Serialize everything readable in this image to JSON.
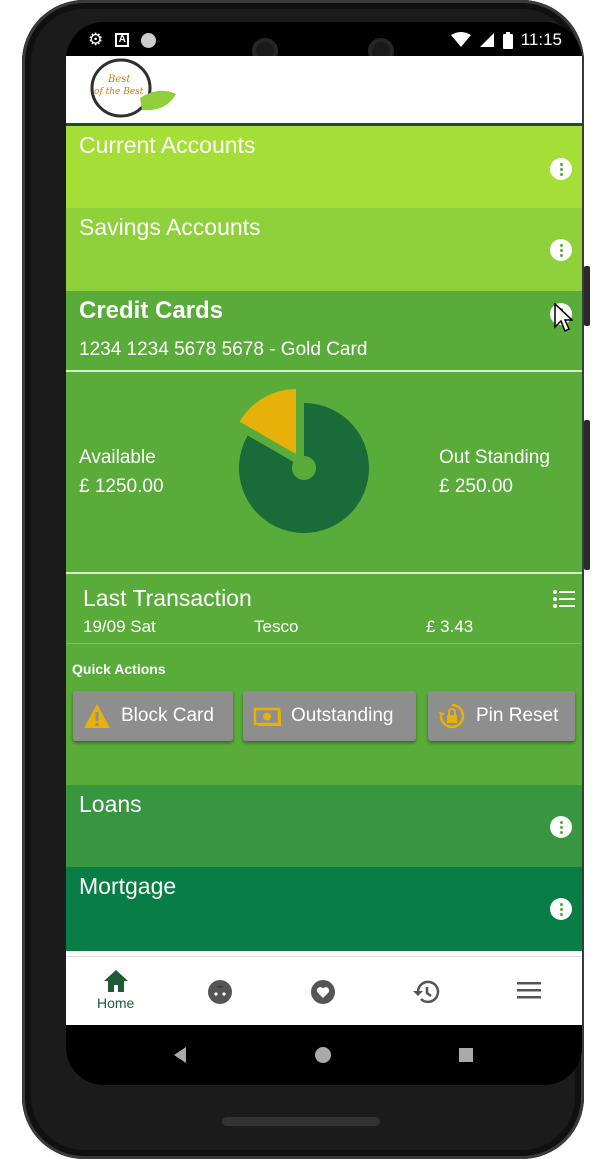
{
  "status_bar": {
    "time": "11:15",
    "icons_left": [
      "gear-icon",
      "a-icon",
      "circle-icon"
    ],
    "icons_right": [
      "wifi-icon",
      "signal-icon",
      "battery-icon"
    ]
  },
  "logo": {
    "line1": "Best",
    "line2": "of the Best"
  },
  "sections": {
    "current": {
      "title": "Current Accounts"
    },
    "savings": {
      "title": "Savings Accounts"
    },
    "credit": {
      "title": "Credit Cards",
      "card_number": "1234 1234 5678 5678 - Gold Card",
      "available_label": "Available",
      "available_value": "£ 1250.00",
      "outstanding_label": "Out Standing",
      "outstanding_value": "£ 250.00",
      "chart_data": {
        "type": "pie",
        "categories": [
          "Available",
          "Out Standing"
        ],
        "values": [
          1250,
          250
        ],
        "colors": [
          "#1a6a3a",
          "#e8b10a"
        ]
      },
      "last_transaction": {
        "title": "Last Transaction",
        "date": "19/09 Sat",
        "merchant": "Tesco",
        "amount": "£ 3.43"
      },
      "quick_actions": {
        "title": "Quick Actions",
        "buttons": [
          {
            "label": "Block Card",
            "icon": "warning-icon"
          },
          {
            "label": "Outstanding",
            "icon": "money-icon"
          },
          {
            "label": "Pin Reset",
            "icon": "lock-reset-icon"
          }
        ]
      }
    },
    "loans": {
      "title": "Loans"
    },
    "mortgage": {
      "title": "Mortgage"
    }
  },
  "bottom_nav": {
    "items": [
      {
        "label": "Home",
        "icon": "home-icon",
        "active": true
      },
      {
        "label": "",
        "icon": "face-icon"
      },
      {
        "label": "",
        "icon": "heart-icon"
      },
      {
        "label": "",
        "icon": "history-icon"
      },
      {
        "label": "",
        "icon": "menu-icon"
      }
    ]
  },
  "colors": {
    "current": "#a5de36",
    "savings": "#8fd13b",
    "credit": "#5aac3a",
    "loans": "#379640",
    "mortgage": "#087d45",
    "accent": "#e8b10a"
  }
}
